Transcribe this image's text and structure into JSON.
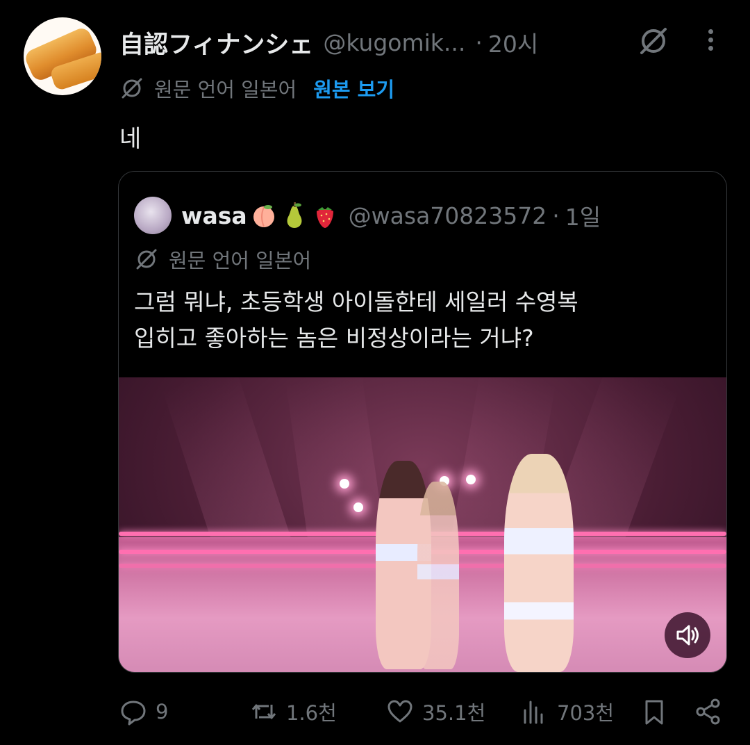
{
  "tweet": {
    "author_name": "自認フィナンシェ",
    "handle": "@kugomik...",
    "separator": "·",
    "time": "20시",
    "translated_from": "원문 언어 일본어",
    "show_original": "원본 보기",
    "text": "네"
  },
  "quote": {
    "author_name": "wasa",
    "emojis": [
      "peach-emoji",
      "pear-emoji",
      "strawberry-emoji"
    ],
    "handle": "@wasa70823572",
    "separator": "·",
    "time": "1일",
    "translated_from": "원문 언어 일본어",
    "text_line1": "그럼 뭐냐, 초등학생 아이돌한테 세일러 수영복",
    "text_line2": "입히고 좋아하는 놈은 비정상이라는 거냐?"
  },
  "actions": {
    "replies": "9",
    "reposts": "1.6천",
    "likes": "35.1천",
    "views": "703천"
  },
  "colors": {
    "background": "#000000",
    "text_primary": "#e7e9ea",
    "text_secondary": "#71767b",
    "link_blue": "#1d9bf0",
    "border": "#333639"
  },
  "icons": {
    "grok": "grok-icon",
    "more": "more-icon",
    "translate": "translate-icon",
    "reply": "reply-icon",
    "repost": "repost-icon",
    "like": "heart-icon",
    "views": "views-icon",
    "bookmark": "bookmark-icon",
    "share": "share-icon",
    "sound": "speaker-icon"
  }
}
